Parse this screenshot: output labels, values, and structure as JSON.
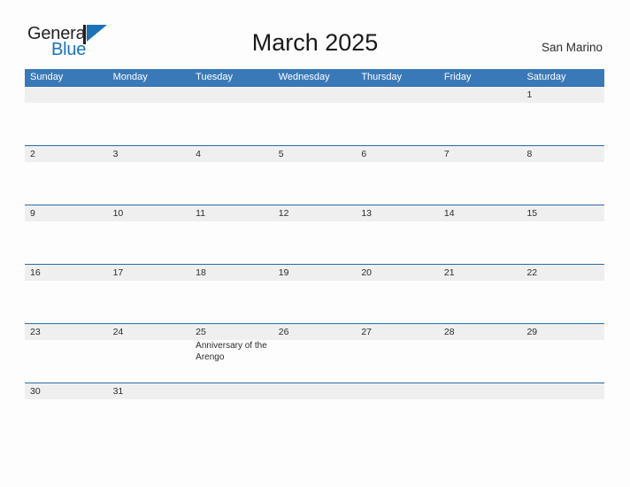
{
  "brand": {
    "word_one": "General",
    "word_two": "Blue",
    "mark_icon": "triangle-flag-icon",
    "accent_color": "#1b72b8"
  },
  "header": {
    "title": "March 2025",
    "location": "San Marino"
  },
  "theme": {
    "header_blue": "#3a79b8",
    "row_border_blue": "#2d6ca8",
    "date_band_gray": "#efefef",
    "page_background": "#fdfdfd"
  },
  "calendar": {
    "weekdays": [
      "Sunday",
      "Monday",
      "Tuesday",
      "Wednesday",
      "Thursday",
      "Friday",
      "Saturday"
    ],
    "weeks": [
      {
        "days": [
          {
            "number": "",
            "events": []
          },
          {
            "number": "",
            "events": []
          },
          {
            "number": "",
            "events": []
          },
          {
            "number": "",
            "events": []
          },
          {
            "number": "",
            "events": []
          },
          {
            "number": "",
            "events": []
          },
          {
            "number": "1",
            "events": []
          }
        ]
      },
      {
        "days": [
          {
            "number": "2",
            "events": []
          },
          {
            "number": "3",
            "events": []
          },
          {
            "number": "4",
            "events": []
          },
          {
            "number": "5",
            "events": []
          },
          {
            "number": "6",
            "events": []
          },
          {
            "number": "7",
            "events": []
          },
          {
            "number": "8",
            "events": []
          }
        ]
      },
      {
        "days": [
          {
            "number": "9",
            "events": []
          },
          {
            "number": "10",
            "events": []
          },
          {
            "number": "11",
            "events": []
          },
          {
            "number": "12",
            "events": []
          },
          {
            "number": "13",
            "events": []
          },
          {
            "number": "14",
            "events": []
          },
          {
            "number": "15",
            "events": []
          }
        ]
      },
      {
        "days": [
          {
            "number": "16",
            "events": []
          },
          {
            "number": "17",
            "events": []
          },
          {
            "number": "18",
            "events": []
          },
          {
            "number": "19",
            "events": []
          },
          {
            "number": "20",
            "events": []
          },
          {
            "number": "21",
            "events": []
          },
          {
            "number": "22",
            "events": []
          }
        ]
      },
      {
        "days": [
          {
            "number": "23",
            "events": []
          },
          {
            "number": "24",
            "events": []
          },
          {
            "number": "25",
            "events": [
              "Anniversary of the Arengo"
            ]
          },
          {
            "number": "26",
            "events": []
          },
          {
            "number": "27",
            "events": []
          },
          {
            "number": "28",
            "events": []
          },
          {
            "number": "29",
            "events": []
          }
        ]
      },
      {
        "days": [
          {
            "number": "30",
            "events": []
          },
          {
            "number": "31",
            "events": []
          },
          {
            "number": "",
            "events": []
          },
          {
            "number": "",
            "events": []
          },
          {
            "number": "",
            "events": []
          },
          {
            "number": "",
            "events": []
          },
          {
            "number": "",
            "events": []
          }
        ]
      }
    ]
  }
}
